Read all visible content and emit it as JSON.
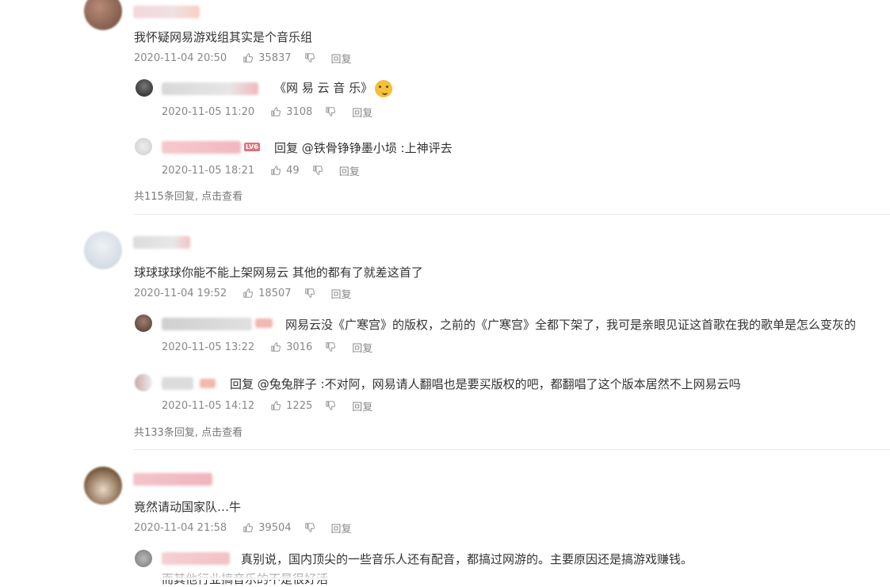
{
  "vip_badge": "LV6",
  "comments": [
    {
      "text": "我怀疑网易游戏组其实是个音乐组",
      "date": "2020-11-04 20:50",
      "likes": "35837",
      "reply_label": "回复",
      "replies": [
        {
          "text": "《网 易 云 音 乐》",
          "date": "2020-11-05 11:20",
          "likes": "3108",
          "reply_label": "回复"
        },
        {
          "text": "回复 @铁骨铮铮墨小埙 :上神评去",
          "date": "2020-11-05 18:21",
          "likes": "49",
          "reply_label": "回复"
        }
      ],
      "more": "共115条回复, 点击查看"
    },
    {
      "text": "球球球球你能不能上架网易云 其他的都有了就差这首了",
      "date": "2020-11-04 19:52",
      "likes": "18507",
      "reply_label": "回复",
      "replies": [
        {
          "text": "网易云没《广寒宫》的版权，之前的《广寒宫》全都下架了，我可是亲眼见证这首歌在我的歌单是怎么变灰的",
          "date": "2020-11-05 13:22",
          "likes": "3016",
          "reply_label": "回复"
        },
        {
          "text": "回复 @兔兔胖子 :不对阿，网易请人翻唱也是要买版权的吧，都翻唱了这个版本居然不上网易云吗",
          "date": "2020-11-05 14:12",
          "likes": "1225",
          "reply_label": "回复"
        }
      ],
      "more": "共133条回复, 点击查看"
    },
    {
      "text": "竟然请动国家队…牛",
      "date": "2020-11-04 21:58",
      "likes": "39504",
      "reply_label": "回复",
      "replies": [
        {
          "text": "真别说，国内顶尖的一些音乐人还有配音，都搞过网游的。主要原因还是搞游戏赚钱。",
          "date": "",
          "likes": "",
          "reply_label": ""
        }
      ],
      "continued_text": "而其他行业搞音乐的不是很好活"
    }
  ]
}
